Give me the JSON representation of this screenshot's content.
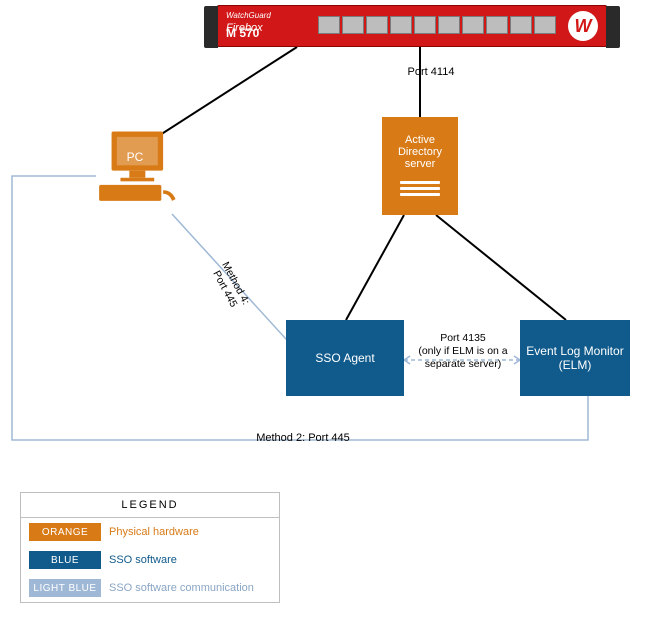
{
  "firebox": {
    "brand_top": "WatchGuard",
    "brand": "Firebox",
    "model": "M 570",
    "logo": "W"
  },
  "nodes": {
    "pc_label": "PC",
    "ad_line1": "Active",
    "ad_line2": "Directory",
    "ad_line3": "server",
    "sso": "SSO Agent",
    "elm": "Event Log Monitor (ELM)"
  },
  "edges": {
    "port_4114": "Port 4114",
    "port_4135": "Port 4135",
    "port_4135_note": "(only if ELM is on a separate server)",
    "method2": "Method 2: Port 445",
    "method4_a": "Method 4:",
    "method4_b": "Port 445"
  },
  "legend": {
    "title": "LEGEND",
    "rows": [
      {
        "swatch": "ORANGE",
        "desc": "Physical hardware"
      },
      {
        "swatch": "BLUE",
        "desc": "SSO software"
      },
      {
        "swatch": "LIGHT BLUE",
        "desc": "SSO software communication"
      }
    ]
  },
  "colors": {
    "orange": "#d87b17",
    "blue": "#115b8c",
    "lightblue": "#9fb8d6",
    "red": "#d11717"
  }
}
